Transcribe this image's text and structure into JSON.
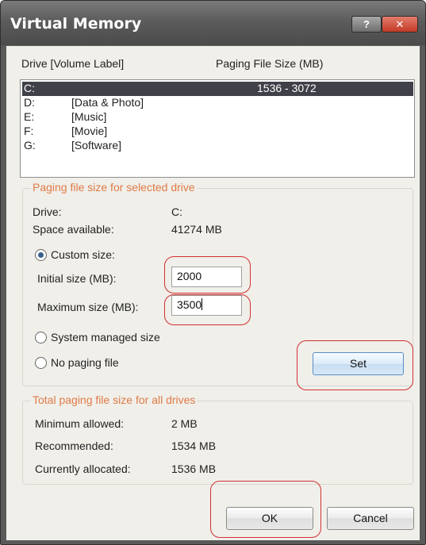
{
  "window": {
    "title": "Virtual Memory",
    "help_label": "?",
    "close_label": "✕"
  },
  "drives_list": {
    "col_drive": "Drive  [Volume Label]",
    "col_paging": "Paging File Size (MB)",
    "rows": [
      {
        "drive": "C:",
        "label": "",
        "size": "1536 - 3072",
        "selected": true
      },
      {
        "drive": "D:",
        "label": "[Data & Photo]",
        "size": ""
      },
      {
        "drive": "E:",
        "label": "[Music]",
        "size": ""
      },
      {
        "drive": "F:",
        "label": "[Movie]",
        "size": ""
      },
      {
        "drive": "G:",
        "label": "[Software]",
        "size": ""
      }
    ]
  },
  "selected_drive": {
    "legend": "Paging file size for selected drive",
    "drive_label": "Drive:",
    "drive_value": "C:",
    "space_label": "Space available:",
    "space_value": "41274 MB",
    "custom_label": "Custom size:",
    "custom_checked": true,
    "initial_label": "Initial size (MB):",
    "initial_value": "2000",
    "max_label": "Maximum size (MB):",
    "max_value": "3500",
    "system_label": "System managed size",
    "none_label": "No paging file",
    "set_label": "Set"
  },
  "totals": {
    "legend": "Total paging file size for all drives",
    "min_label": "Minimum allowed:",
    "min_value": "2 MB",
    "rec_label": "Recommended:",
    "rec_value": "1534 MB",
    "alloc_label": "Currently allocated:",
    "alloc_value": "1536 MB"
  },
  "footer": {
    "ok_label": "OK",
    "cancel_label": "Cancel"
  },
  "colors": {
    "highlight": "#d23030",
    "group_legend": "#e07a46",
    "selection": "#404048"
  }
}
